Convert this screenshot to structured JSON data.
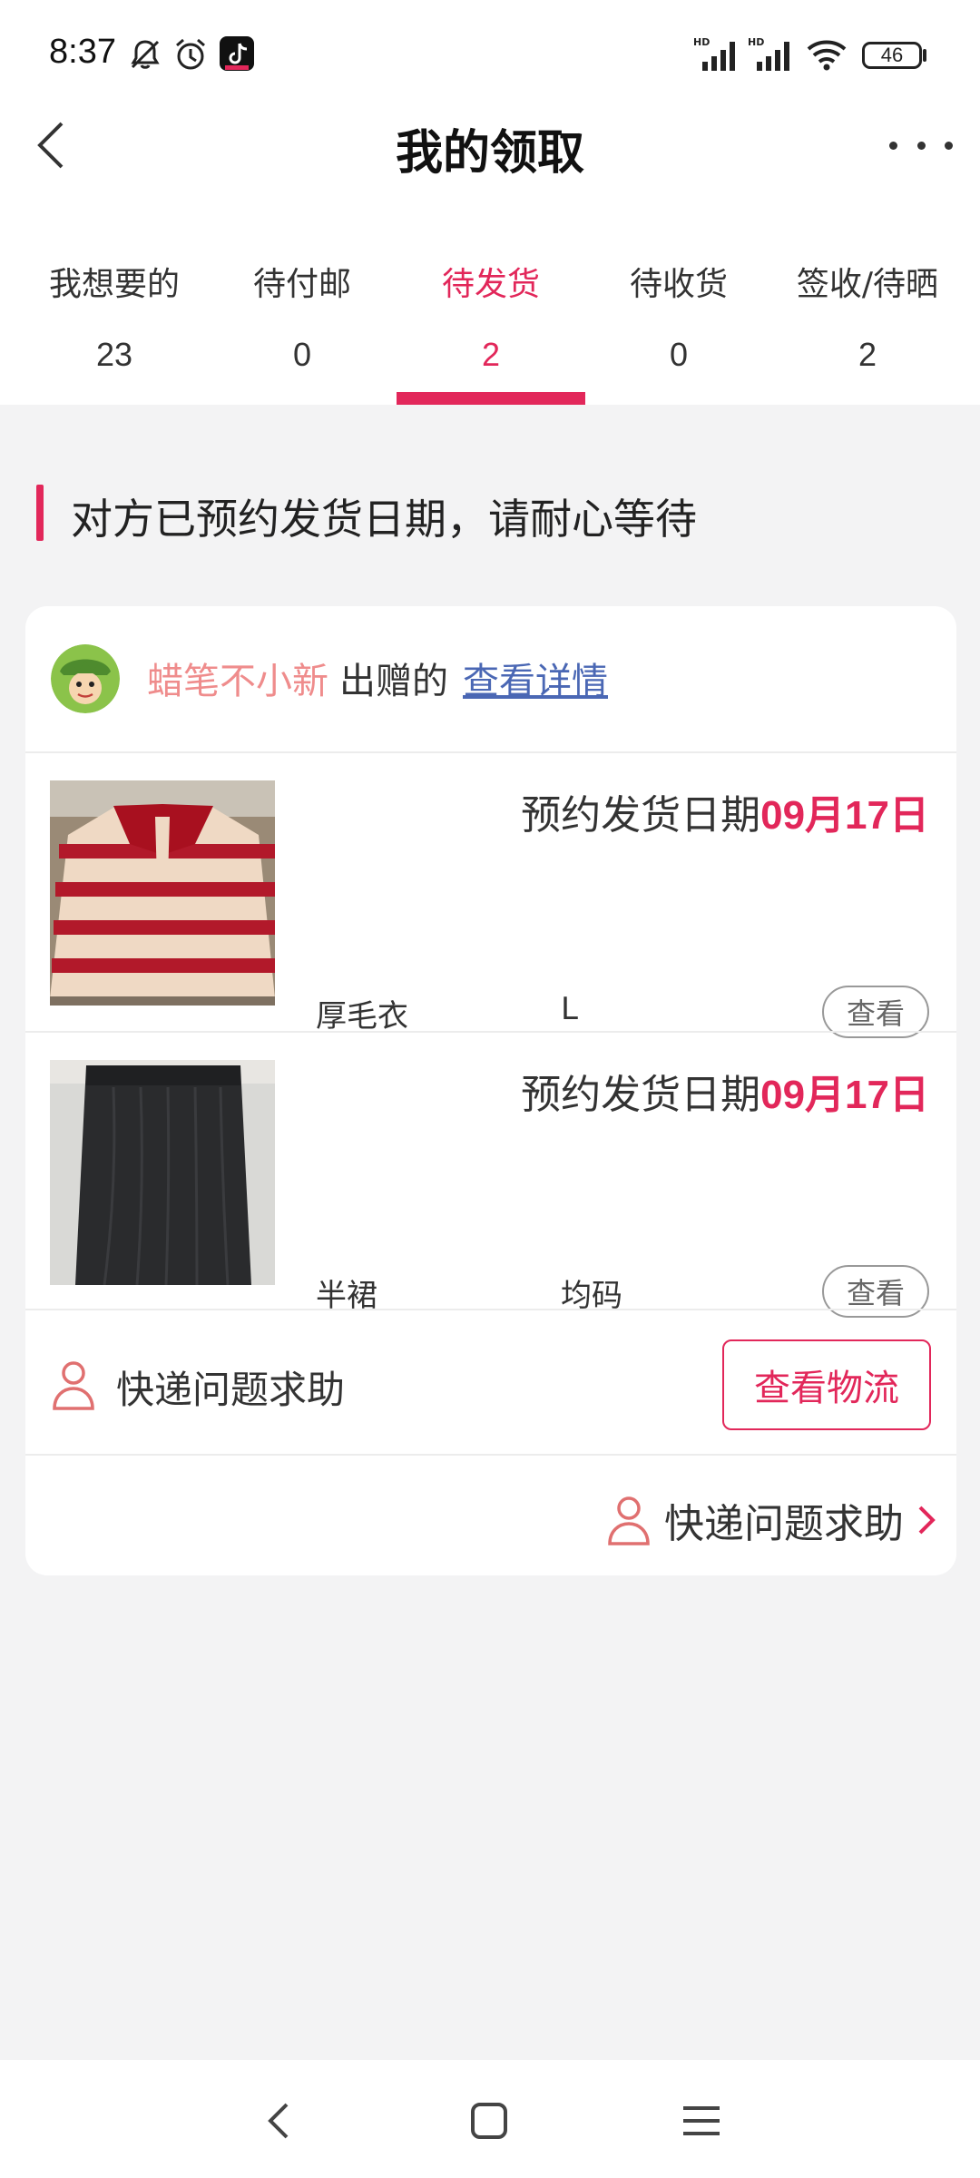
{
  "status_bar": {
    "time": "8:37",
    "battery": "46",
    "icons": [
      "bell-off-icon",
      "alarm-icon",
      "tiktok-icon",
      "signal-icon",
      "signal-icon",
      "wifi-icon",
      "battery-icon"
    ]
  },
  "header": {
    "title": "我的领取",
    "back_icon": "chevron-left-icon",
    "more_icon": "more-icon"
  },
  "tabs": [
    {
      "label": "我想要的",
      "count": "23"
    },
    {
      "label": "待付邮",
      "count": "0"
    },
    {
      "label": "待发货",
      "count": "2",
      "active": true
    },
    {
      "label": "待收货",
      "count": "0"
    },
    {
      "label": "签收/待晒",
      "count": "2"
    }
  ],
  "banner": {
    "text": "对方已预约发货日期，请耐心等待"
  },
  "card": {
    "giver_name": "蜡笔不小新",
    "giver_suffix": "出赠的",
    "detail_link": "查看详情",
    "items": [
      {
        "ship_label": "预约发货日期",
        "ship_date": "09月17日",
        "name": "厚毛衣",
        "size": "L",
        "view_label": "查看"
      },
      {
        "ship_label": "预约发货日期",
        "ship_date": "09月17日",
        "name": "半裙",
        "size": "均码",
        "view_label": "查看"
      }
    ],
    "help_text": "快递问题求助",
    "logistics_button": "查看物流",
    "help_link": "快递问题求助"
  },
  "colors": {
    "accent": "#e2275a",
    "giver_name": "#ef8c8c",
    "link": "#4a67b4",
    "background": "#f3f3f4"
  }
}
